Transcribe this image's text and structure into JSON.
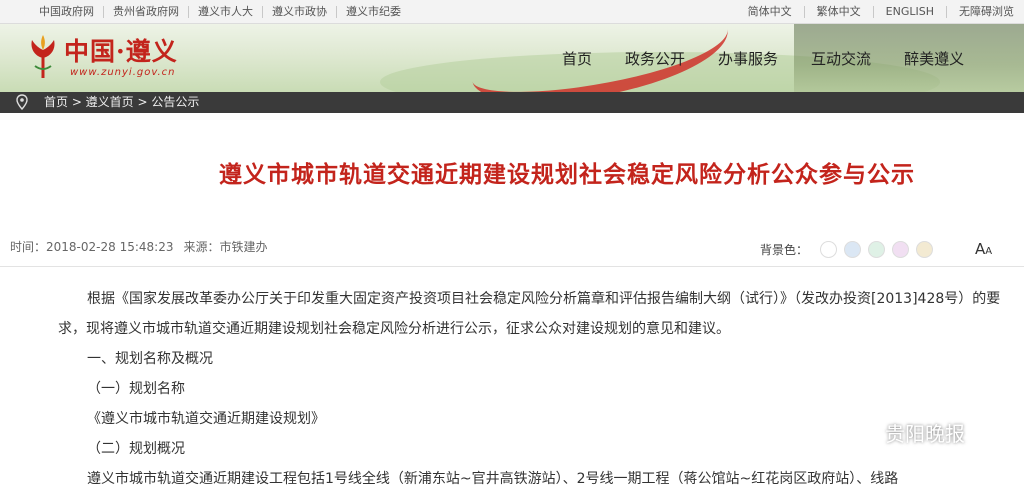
{
  "topbar": {
    "links": [
      "中国政府网",
      "贵州省政府网",
      "遵义市人大",
      "遵义市政协",
      "遵义市纪委"
    ],
    "lang": [
      "简体中文",
      "繁体中文",
      "ENGLISH",
      "无障碍浏览"
    ]
  },
  "header": {
    "logo_text": "中国·遵义",
    "logo_url": "www.zunyi.gov.cn",
    "nav": [
      "首页",
      "政务公开",
      "办事服务",
      "互动交流",
      "醉美遵义"
    ]
  },
  "breadcrumb": "首页 > 遵义首页 > 公告公示",
  "article": {
    "title": "遵义市城市轨道交通近期建设规划社会稳定风险分析公众参与公示",
    "time_label": "时间：",
    "time": "2018-02-28 15:48:23",
    "source_label": "来源：",
    "source": "市铁建办",
    "bg_label": "背景色：",
    "font_icon": "A",
    "font_icon_small": "A",
    "paragraphs": [
      "根据《国家发展改革委办公厅关于印发重大固定资产投资项目社会稳定风险分析篇章和评估报告编制大纲（试行）》（发改办投资[2013]428号）的要",
      "求，现将遵义市城市轨道交通近期建设规划社会稳定风险分析进行公示，征求公众对建设规划的意见和建议。",
      "一、规划名称及概况",
      "（一）规划名称",
      "《遵义市城市轨道交通近期建设规划》",
      "（二）规划概况",
      "遵义市城市轨道交通近期建设工程包括1号线全线（新浦东站~官井高铁游站）、2号线一期工程（蒋公馆站~红花岗区政府站）、线路"
    ]
  },
  "bg_swatches": [
    "#ffffff",
    "#dbe7f4",
    "#dff1e6",
    "#f1dff2",
    "#f3ead2"
  ],
  "watermark": "贵阳晚报",
  "colors": {
    "accent": "#c3241c",
    "crumb_bg": "#3a3a3a"
  }
}
